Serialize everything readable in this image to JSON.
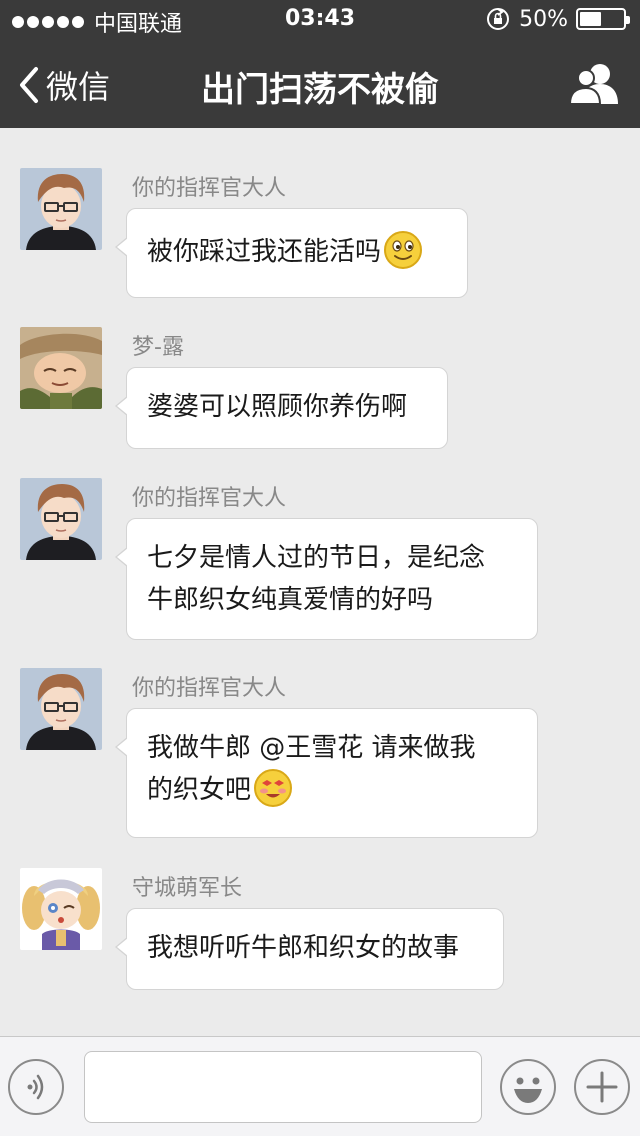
{
  "status_bar": {
    "carrier": "中国联通",
    "time": "03:43",
    "battery_percent": "50%",
    "battery_level": 0.5
  },
  "nav": {
    "back_label": "微信",
    "title": "出门扫荡不被偷"
  },
  "messages": [
    {
      "sender": "你的指挥官大人",
      "text": "被你踩过我还能活吗",
      "emoji": "smile-emoji"
    },
    {
      "sender": "梦-露",
      "text": "婆婆可以照顾你养伤啊"
    },
    {
      "sender": "你的指挥官大人",
      "line1": "七夕是情人过的节日，是纪念",
      "line2": "牛郎织女纯真爱情的好吗"
    },
    {
      "sender": "你的指挥官大人",
      "line1": "我做牛郎 @王雪花 请来做我",
      "line2": "的织女吧",
      "emoji": "excited-emoji"
    },
    {
      "sender": "守城萌军长",
      "text": "我想听听牛郎和织女的故事"
    }
  ],
  "input": {
    "placeholder": ""
  },
  "colors": {
    "nav_bg": "#3a3a3a",
    "chat_bg": "#ebebeb",
    "bubble_bg": "#ffffff",
    "sender_text": "#888888"
  }
}
